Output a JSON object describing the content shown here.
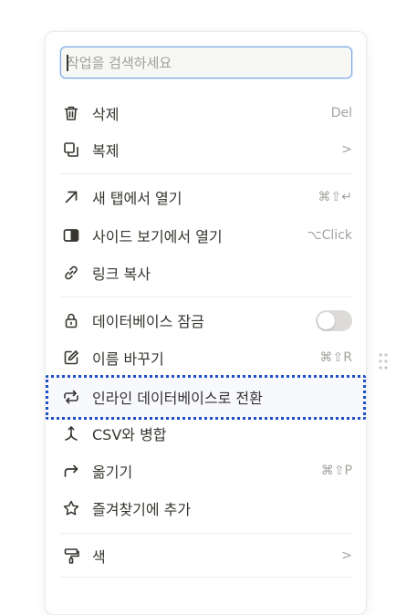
{
  "search": {
    "placeholder": "작업을 검색하세요"
  },
  "menu": {
    "items": [
      {
        "label": "삭제",
        "shortcut": "Del"
      },
      {
        "label": "복제",
        "shortcut": ">"
      },
      {
        "label": "새 탭에서 열기",
        "shortcut": "⌘⇧↵"
      },
      {
        "label": "사이드 보기에서 열기",
        "shortcut": "⌥Click"
      },
      {
        "label": "링크 복사"
      },
      {
        "label": "데이터베이스 잠금",
        "toggle": false
      },
      {
        "label": "이름 바꾸기",
        "shortcut": "⌘⇧R"
      },
      {
        "label": "인라인 데이터베이스로 전환"
      },
      {
        "label": "CSV와 병합"
      },
      {
        "label": "옮기기",
        "shortcut": "⌘⇧P"
      },
      {
        "label": "즐겨찾기에 추가"
      },
      {
        "label": "색",
        "shortcut": ">"
      }
    ]
  },
  "colors": {
    "highlight": "#1f4fc6",
    "focus": "#7aa7e3",
    "text": "#37352f",
    "muted": "#a3a29e"
  },
  "icons": [
    "trash-icon",
    "duplicate-icon",
    "arrow-up-right-icon",
    "side-peek-icon",
    "link-icon",
    "lock-icon",
    "rename-icon",
    "convert-inline-icon",
    "merge-icon",
    "move-icon",
    "star-icon",
    "color-icon"
  ]
}
